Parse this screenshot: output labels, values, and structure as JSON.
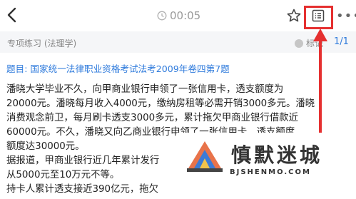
{
  "header": {
    "timer": "00:05",
    "icons": [
      "back-icon",
      "clock-icon",
      "star-icon",
      "answer-sheet-icon",
      "more-icon"
    ]
  },
  "subheader": {
    "category": "专项练习 (法理学)",
    "mark_label": "标记",
    "page_indicator": "1/1"
  },
  "question": {
    "title": "题目: 国家统一法律职业资格考试法考2009年卷四第7题",
    "lines": [
      "潘晓大学毕业不久，向甲商业银行申领了一张信用卡，透支额度为",
      "20000元。潘晓每月收入4000元，缴纳房租等必需开销3000多元。潘晓",
      "消费观念前卫，每月刷卡透支3000多元，累计拖欠甲商业银行借款近",
      "60000元。不久，潘晓又向乙商业银行申领了一张信用卡，透支额度",
      "额度达30000元。",
      "据报道，甲商业银行近几年累计发行",
      "从5000元至10万元不等。",
      "持卡人累计透支接近390亿元，拖欠"
    ]
  },
  "watermark": {
    "brand": "慎默迷城",
    "url": "BJSHENMO.COM"
  },
  "colors": {
    "accent_blue": "#2f7bdc",
    "highlight_red": "#e53030",
    "subbar_bg": "#f5f6f8"
  }
}
